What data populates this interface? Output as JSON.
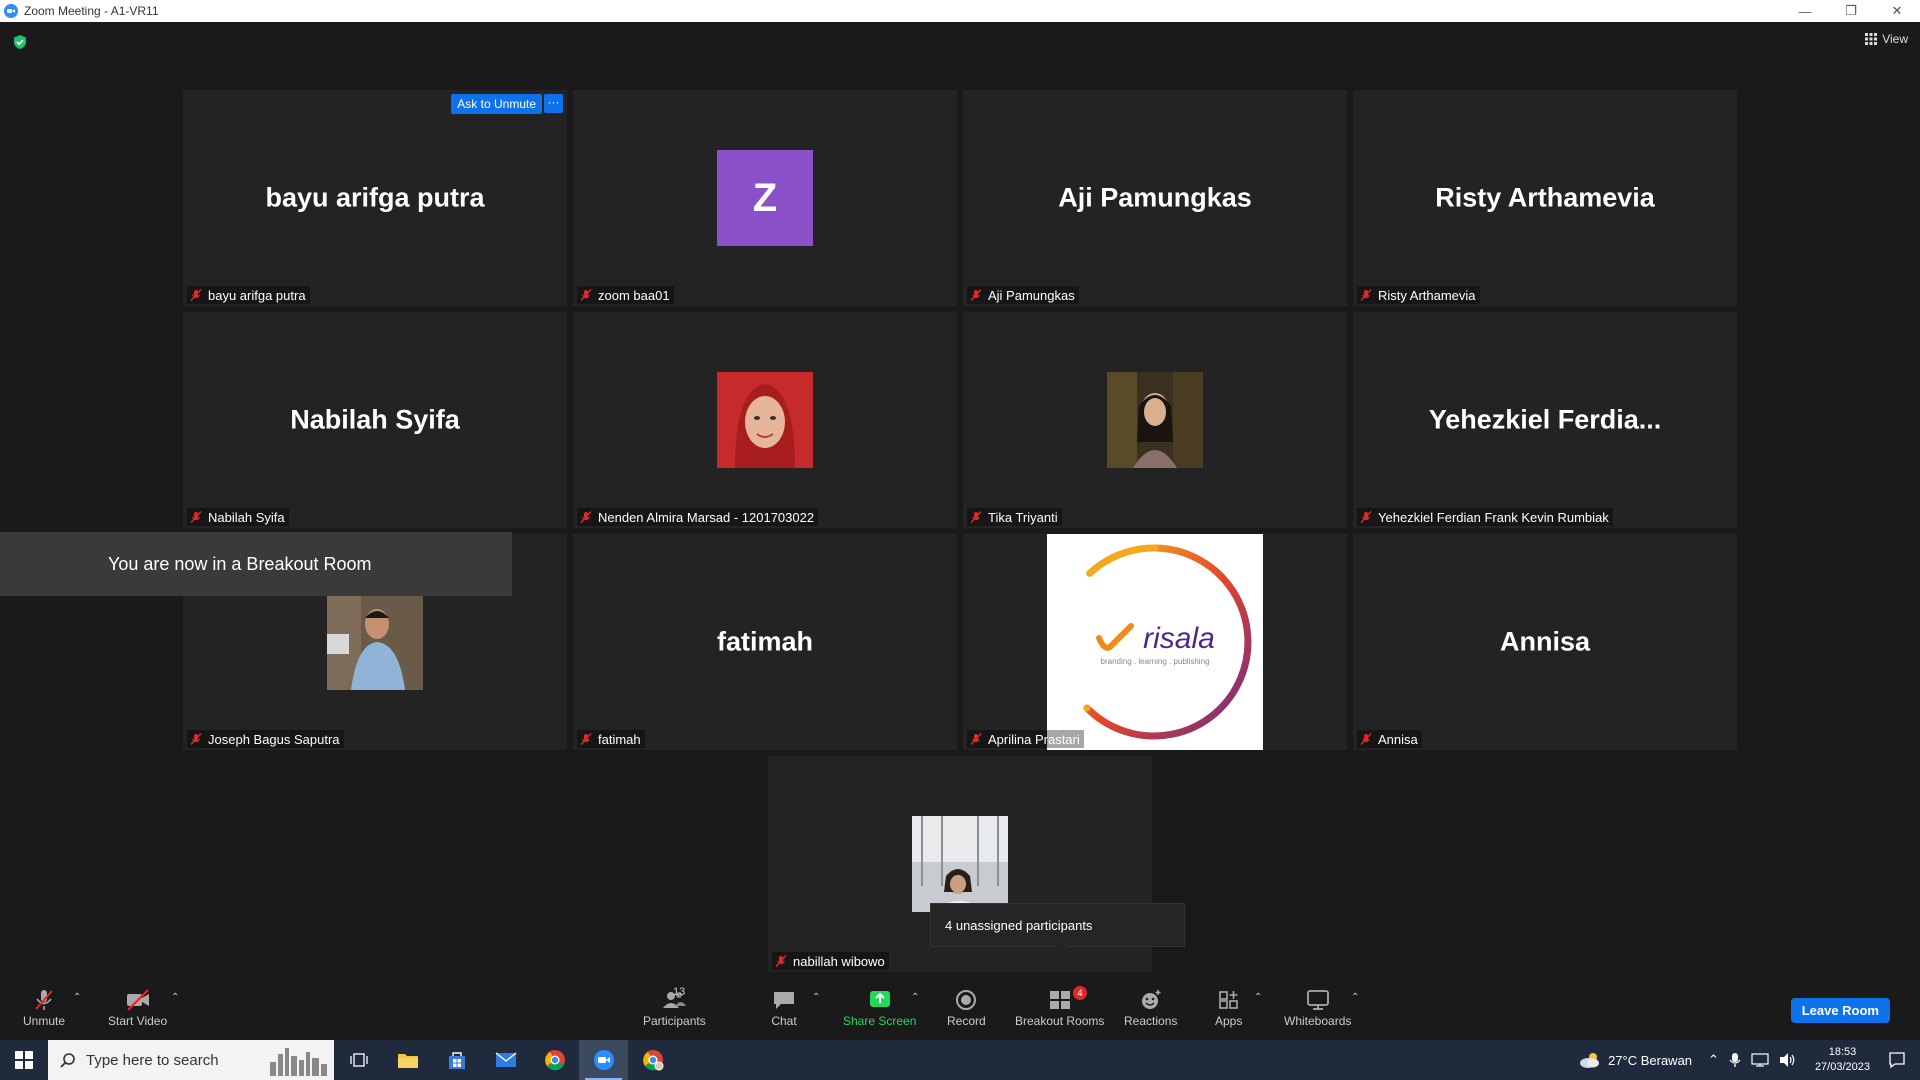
{
  "window": {
    "title": "Zoom Meeting - A1-VR11"
  },
  "meeting": {
    "view_label": "View",
    "ask_to_unmute": "Ask to Unmute",
    "more": "···",
    "breakout_banner": "You are now in a Breakout Room",
    "unassigned_tip": "4 unassigned participants",
    "tiles": [
      {
        "display": "bayu arifga putra",
        "label": "bayu arifga putra"
      },
      {
        "display": "Z",
        "label": "zoom baa01"
      },
      {
        "display": "Aji Pamungkas",
        "label": "Aji Pamungkas"
      },
      {
        "display": "Risty Arthamevia",
        "label": "Risty Arthamevia"
      },
      {
        "display": "Nabilah Syifa",
        "label": "Nabilah Syifa"
      },
      {
        "display": "",
        "label": "Nenden Almira Marsad - 1201703022"
      },
      {
        "display": "",
        "label": "Tika Triyanti"
      },
      {
        "display": "Yehezkiel  Ferdia...",
        "label": "Yehezkiel Ferdian Frank Kevin Rumbiak"
      },
      {
        "display": "",
        "label": "Joseph Bagus Saputra"
      },
      {
        "display": "fatimah",
        "label": "fatimah"
      },
      {
        "display": "",
        "label": "Aprilina Prastari"
      },
      {
        "display": "Annisa",
        "label": "Annisa"
      },
      {
        "display": "",
        "label": "nabillah wibowo"
      }
    ],
    "risala_logo": {
      "word": "risala",
      "tagline": "branding . learning . publishing"
    }
  },
  "toolbar": {
    "unmute": "Unmute",
    "start_video": "Start Video",
    "participants": "Participants",
    "participants_count": "13",
    "chat": "Chat",
    "share_screen": "Share Screen",
    "record": "Record",
    "breakout_rooms": "Breakout Rooms",
    "breakout_badge": "4",
    "reactions": "Reactions",
    "apps": "Apps",
    "whiteboards": "Whiteboards",
    "leave": "Leave Room"
  },
  "taskbar": {
    "search_placeholder": "Type here to search",
    "weather": "27°C  Berawan",
    "time": "18:53",
    "date": "27/03/2023"
  },
  "colors": {
    "accent": "#0e72ed",
    "share_green": "#23d959",
    "muted_red": "#e02828",
    "tile_bg": "#232323"
  }
}
